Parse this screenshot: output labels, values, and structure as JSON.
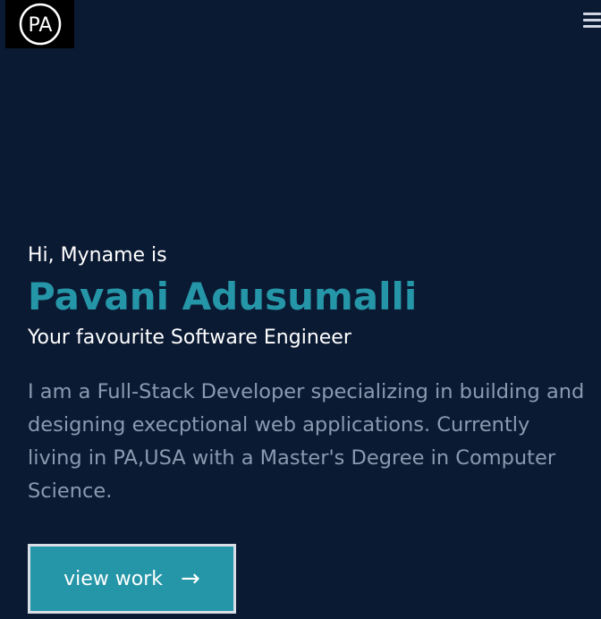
{
  "header": {
    "logo_text": "PA",
    "menu_icon": "hamburger-menu-icon"
  },
  "hero": {
    "greeting": "Hi, Myname is",
    "name": "Pavani Adusumalli",
    "role": "Your favourite Software Engineer",
    "bio": "I am a Full-Stack Developer specializing in building and designing execptional web applications. Currently living in PA,USA with a Master's Degree in Computer Science.",
    "cta_label": "view work",
    "cta_icon": "arrow-right-icon"
  },
  "colors": {
    "background": "#0b1a33",
    "accent": "#2596a8",
    "text_primary": "#ffffff",
    "text_muted": "#8c9ab0"
  }
}
